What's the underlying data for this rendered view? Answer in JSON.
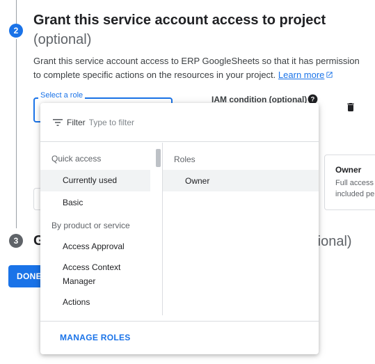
{
  "step2": {
    "number": "2",
    "title": "Grant this service account access to project",
    "subtitle": "(optional)",
    "description": "Grant this service account access to ERP GoogleSheets so that it has permission to complete specific actions on the resources in your project.",
    "learn_more": "Learn more",
    "role_field_label": "Select a role",
    "iam_condition_label": "IAM condition (optional)"
  },
  "role_card": {
    "title": "Owner",
    "line1": "Full access",
    "line2": "included pe"
  },
  "step3": {
    "number": "3",
    "title_visible": "G",
    "title_tail": "ptional)"
  },
  "done_button": "DONE",
  "dropdown": {
    "filter_label": "Filter",
    "filter_placeholder": "Type to filter",
    "sections": [
      {
        "heading": "Quick access",
        "items": [
          "Currently used",
          "Basic"
        ]
      },
      {
        "heading": "By product or service",
        "items": [
          "Access Approval",
          "Access Context Manager",
          "Actions"
        ]
      }
    ],
    "selected_category": "Currently used",
    "roles_heading": "Roles",
    "roles": [
      "Owner"
    ],
    "manage_roles": "MANAGE ROLES"
  },
  "colors": {
    "accent": "#1a73e8",
    "step_inactive": "#5f6368",
    "selected_bg": "#f1f3f4",
    "divider": "#dadce0"
  }
}
